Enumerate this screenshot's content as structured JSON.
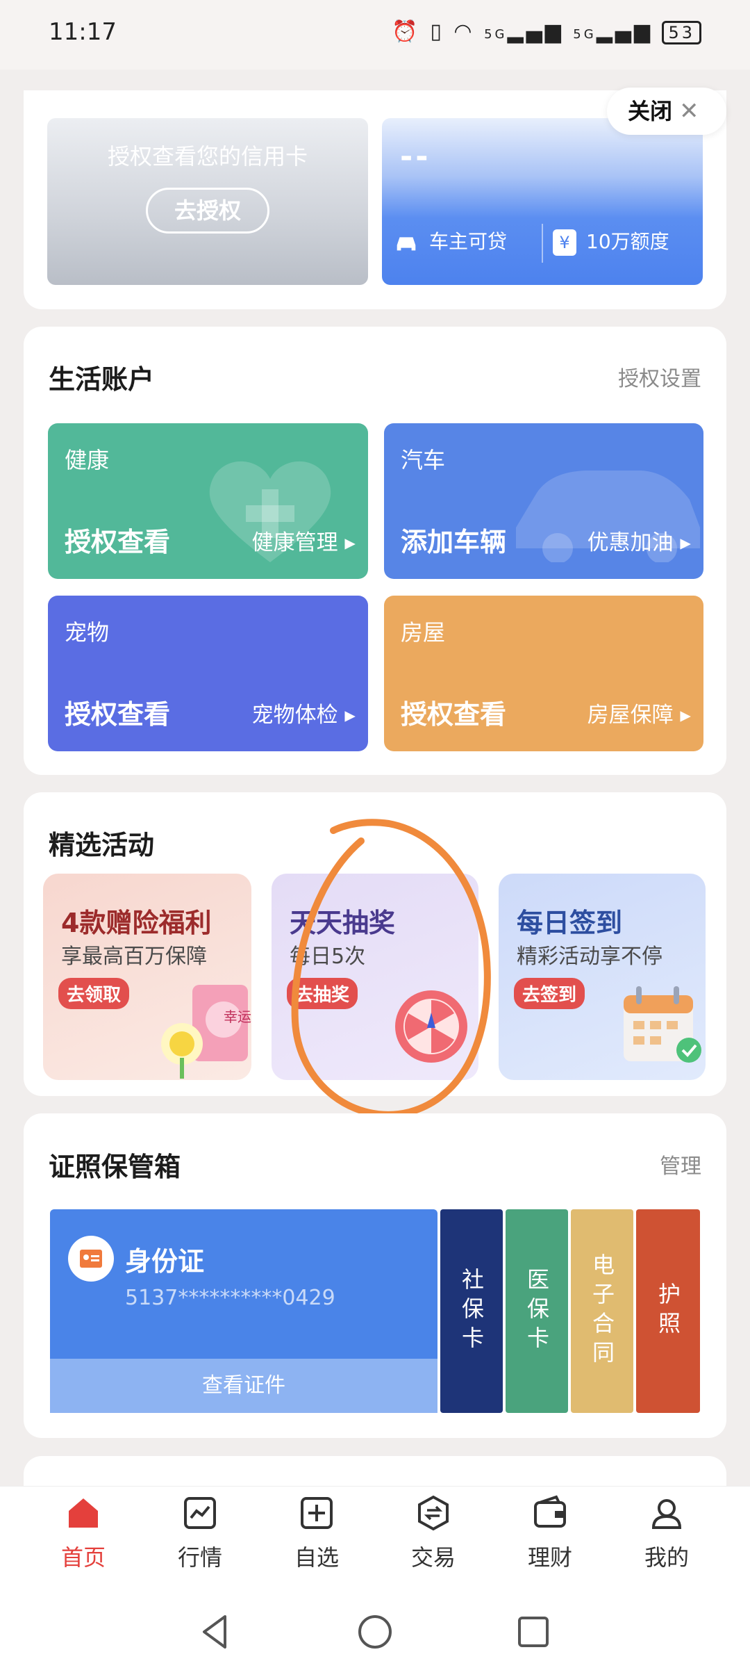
{
  "status_bar": {
    "time": "11:17",
    "signal_label": "5G",
    "battery": "53"
  },
  "credit_card": {
    "prompt": "授权查看您的信用卡",
    "authorize_button": "去授权"
  },
  "loan_card": {
    "value": "--",
    "left_label": "车主可贷",
    "right_label": "10万额度",
    "yuan_symbol": "¥"
  },
  "close_button": {
    "label": "关闭",
    "x": "✕"
  },
  "life_account": {
    "title": "生活账户",
    "settings": "授权设置",
    "tiles": [
      {
        "label": "健康",
        "main": "授权查看",
        "link": "健康管理 ▸",
        "color": "#52b899"
      },
      {
        "label": "汽车",
        "main": "添加车辆",
        "link": "优惠加油 ▸",
        "color": "#5785e6"
      },
      {
        "label": "宠物",
        "main": "授权查看",
        "link": "宠物体检 ▸",
        "color": "#5a6de3"
      },
      {
        "label": "房屋",
        "main": "授权查看",
        "link": "房屋保障 ▸",
        "color": "#eba95e"
      }
    ]
  },
  "activities": {
    "title": "精选活动",
    "items": [
      {
        "title": "4款赠险福利",
        "subtitle": "享最高百万保障",
        "badge": "去领取",
        "sticker": "幸运"
      },
      {
        "title": "天天抽奖",
        "subtitle": "每日5次",
        "badge": "去抽奖"
      },
      {
        "title": "每日签到",
        "subtitle": "精彩活动享不停",
        "badge": "去签到"
      }
    ]
  },
  "certificates": {
    "title": "证照保管箱",
    "manage": "管理",
    "id_card": {
      "name": "身份证",
      "number": "5137**********0429",
      "view": "查看证件"
    },
    "tabs": [
      "社保卡",
      "医保卡",
      "电子合同",
      "护照"
    ]
  },
  "bottom_nav": {
    "items": [
      {
        "label": "首页",
        "icon": "home-icon",
        "active": true
      },
      {
        "label": "行情",
        "icon": "chart-icon",
        "active": false
      },
      {
        "label": "自选",
        "icon": "plus-square-icon",
        "active": false
      },
      {
        "label": "交易",
        "icon": "exchange-icon",
        "active": false
      },
      {
        "label": "理财",
        "icon": "wallet-icon",
        "active": false
      },
      {
        "label": "我的",
        "icon": "user-icon",
        "active": false
      }
    ]
  },
  "colors": {
    "accent_red": "#e4403c",
    "highlight_circle": "#f08a3c"
  }
}
